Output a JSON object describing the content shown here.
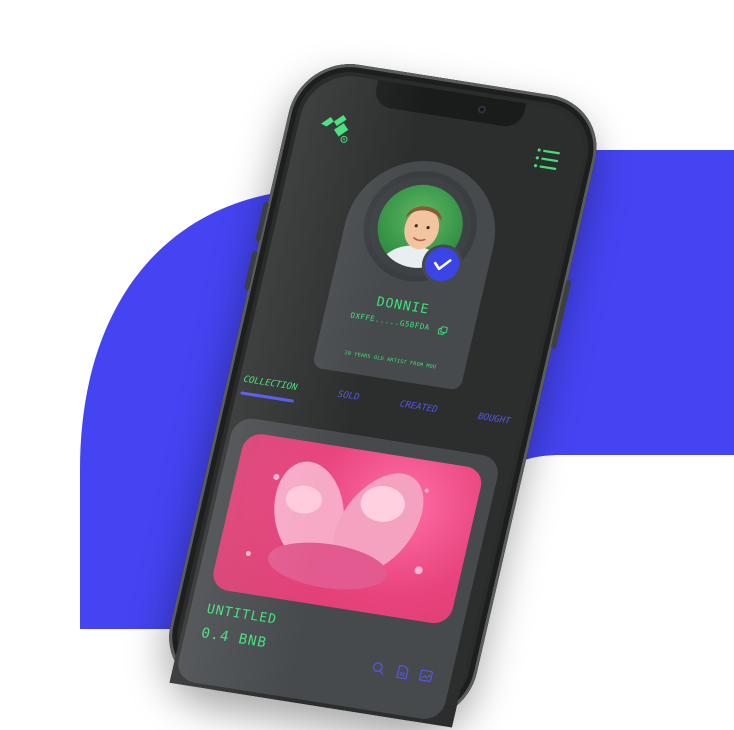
{
  "colors": {
    "accent_blue": "#4444f2",
    "accent_green": "#3fe07a",
    "phone_body": "#2a2b2b",
    "card_bg": "#474a4d",
    "tab_inactive": "#5257e8"
  },
  "header": {
    "logo_icon": "brand-logo-icon",
    "menu_icon": "hamburger-menu-icon"
  },
  "profile": {
    "name": "DONNIE",
    "address": "OXFFE.....G5BFDA",
    "copy_icon": "copy-icon",
    "verified_icon": "check-badge-icon",
    "bio": "20 YEARS OLD ARTIST FROM MOO"
  },
  "tabs": [
    {
      "label": "COLLECTION",
      "active": true
    },
    {
      "label": "SOLD",
      "active": false
    },
    {
      "label": "CREATED",
      "active": false
    },
    {
      "label": "BOUGHT",
      "active": false
    }
  ],
  "nft": {
    "title": "UNTITLED",
    "price": "0.4 BNB",
    "actions": [
      "search-icon",
      "document-icon",
      "image-icon"
    ]
  }
}
